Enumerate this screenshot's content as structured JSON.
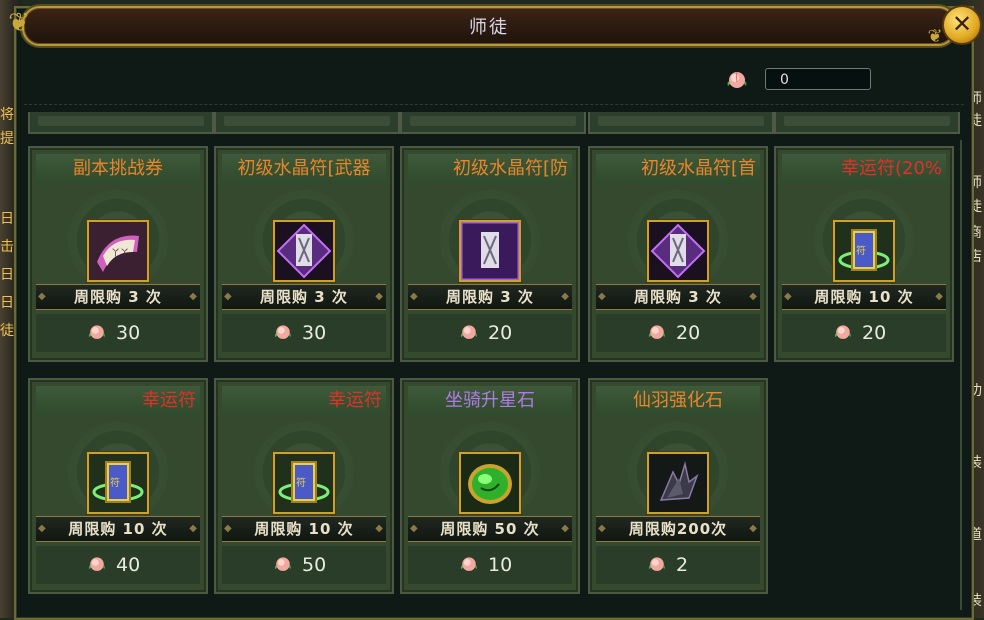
{
  "window": {
    "title": "师徒",
    "close_label": "✕"
  },
  "currency": {
    "icon": "peach-icon",
    "value": "0"
  },
  "colors": {
    "orange": "#e8852a",
    "red": "#e0302a",
    "purple": "#b07ae8"
  },
  "items": [
    {
      "name": "副本挑战券",
      "color": "#e8852a",
      "align": "center",
      "limit": "周限购 3 次",
      "price": "30",
      "icon": "scroll-icon"
    },
    {
      "name": "初级水晶符[武器",
      "color": "#e8852a",
      "align": "center",
      "limit": "周限购 3 次",
      "price": "30",
      "icon": "crystal-talisman-icon"
    },
    {
      "name": "初级水晶符[防",
      "color": "#e8852a",
      "align": "right",
      "limit": "周限购 3 次",
      "price": "20",
      "icon": "crystal-talisman-square-icon"
    },
    {
      "name": "初级水晶符[首",
      "color": "#e8852a",
      "align": "right",
      "limit": "周限购 3 次",
      "price": "20",
      "icon": "crystal-talisman-icon"
    },
    {
      "name": "幸运符(20%",
      "color": "#e0302a",
      "align": "right",
      "limit": "周限购 10 次",
      "price": "20",
      "icon": "luck-charm-icon"
    },
    {
      "name": "幸运符",
      "color": "#e0302a",
      "align": "right",
      "limit": "周限购 10 次",
      "price": "40",
      "icon": "luck-charm-icon"
    },
    {
      "name": "幸运符",
      "color": "#e0302a",
      "align": "right",
      "limit": "周限购 10 次",
      "price": "50",
      "icon": "luck-charm-icon"
    },
    {
      "name": "坐骑升星石",
      "color": "#b07ae8",
      "align": "center",
      "limit": "周限购 50 次",
      "price": "10",
      "icon": "green-gem-icon"
    },
    {
      "name": "仙羽强化石",
      "color": "#e8852a",
      "align": "center",
      "limit": "周限购200次",
      "price": "2",
      "icon": "dark-feather-stone-icon"
    }
  ],
  "background_text": {
    "left": [
      "将",
      "提",
      "日",
      "击",
      "日",
      "日",
      "徒"
    ],
    "right": [
      "师",
      "徒",
      "师",
      "徒",
      "商",
      "店",
      "功",
      "装",
      "道",
      "装"
    ]
  }
}
